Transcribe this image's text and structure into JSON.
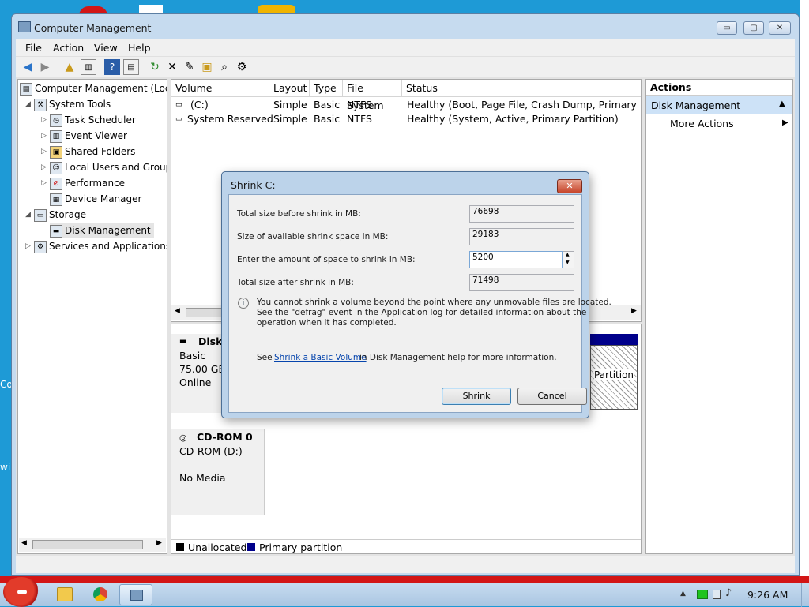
{
  "window": {
    "title": "Computer Management",
    "buttons": {
      "minimize": "▭",
      "maximize": "▢",
      "close": "✕"
    }
  },
  "menu": [
    "File",
    "Action",
    "View",
    "Help"
  ],
  "tree": {
    "root": "Computer Management (Loca",
    "system_tools": "System Tools",
    "task_scheduler": "Task Scheduler",
    "event_viewer": "Event Viewer",
    "shared_folders": "Shared Folders",
    "local_users": "Local Users and Group",
    "performance": "Performance",
    "device_manager": "Device Manager",
    "storage": "Storage",
    "disk_management": "Disk Management",
    "services": "Services and Applications"
  },
  "volume_list": {
    "columns": [
      "Volume",
      "Layout",
      "Type",
      "File System",
      "Status"
    ],
    "rows": [
      {
        "volume": "(C:)",
        "layout": "Simple",
        "type": "Basic",
        "fs": "NTFS",
        "status": "Healthy (Boot, Page File, Crash Dump, Primary Part"
      },
      {
        "volume": "System Reserved",
        "layout": "Simple",
        "type": "Basic",
        "fs": "NTFS",
        "status": "Healthy (System, Active, Primary Partition)"
      }
    ]
  },
  "disks": {
    "disk0": {
      "name": "Disk",
      "type": "Basic",
      "size": "75.00 GB",
      "state": "Online",
      "partition_tail": "Partition"
    },
    "cdrom": {
      "name": "CD-ROM 0",
      "type": "CD-ROM (D:)",
      "media": "No Media"
    }
  },
  "legend": {
    "unallocated": "Unallocated",
    "primary": "Primary partition"
  },
  "actions": {
    "header": "Actions",
    "section": "Disk Management",
    "more": "More Actions"
  },
  "dialog": {
    "title": "Shrink C:",
    "fields": [
      {
        "label": "Total size before shrink in MB:",
        "value": "76698"
      },
      {
        "label": "Size of available shrink space in MB:",
        "value": "29183"
      },
      {
        "label": "Enter the amount of space to shrink in MB:",
        "value": "5200"
      },
      {
        "label": "Total size after shrink in MB:",
        "value": "71498"
      }
    ],
    "info_line1": "You cannot shrink a volume beyond the point where any unmovable files are located.",
    "info_line2": "See the \"defrag\" event in the Application log for detailed information about the",
    "info_line3": "operation when it has completed.",
    "help_pre": "See",
    "help_link": "Shrink a Basic Volume",
    "help_post": "in Disk Management help for more information.",
    "shrink_button": "Shrink",
    "cancel_button": "Cancel"
  },
  "taskbar": {
    "time": "9:26 AM"
  },
  "desktop_edge_text": {
    "left1": "Co",
    "left2": "wi"
  },
  "colors": {
    "primary_partition": "#00008b",
    "unallocated": "#000000",
    "selection": "#cde2f7"
  }
}
